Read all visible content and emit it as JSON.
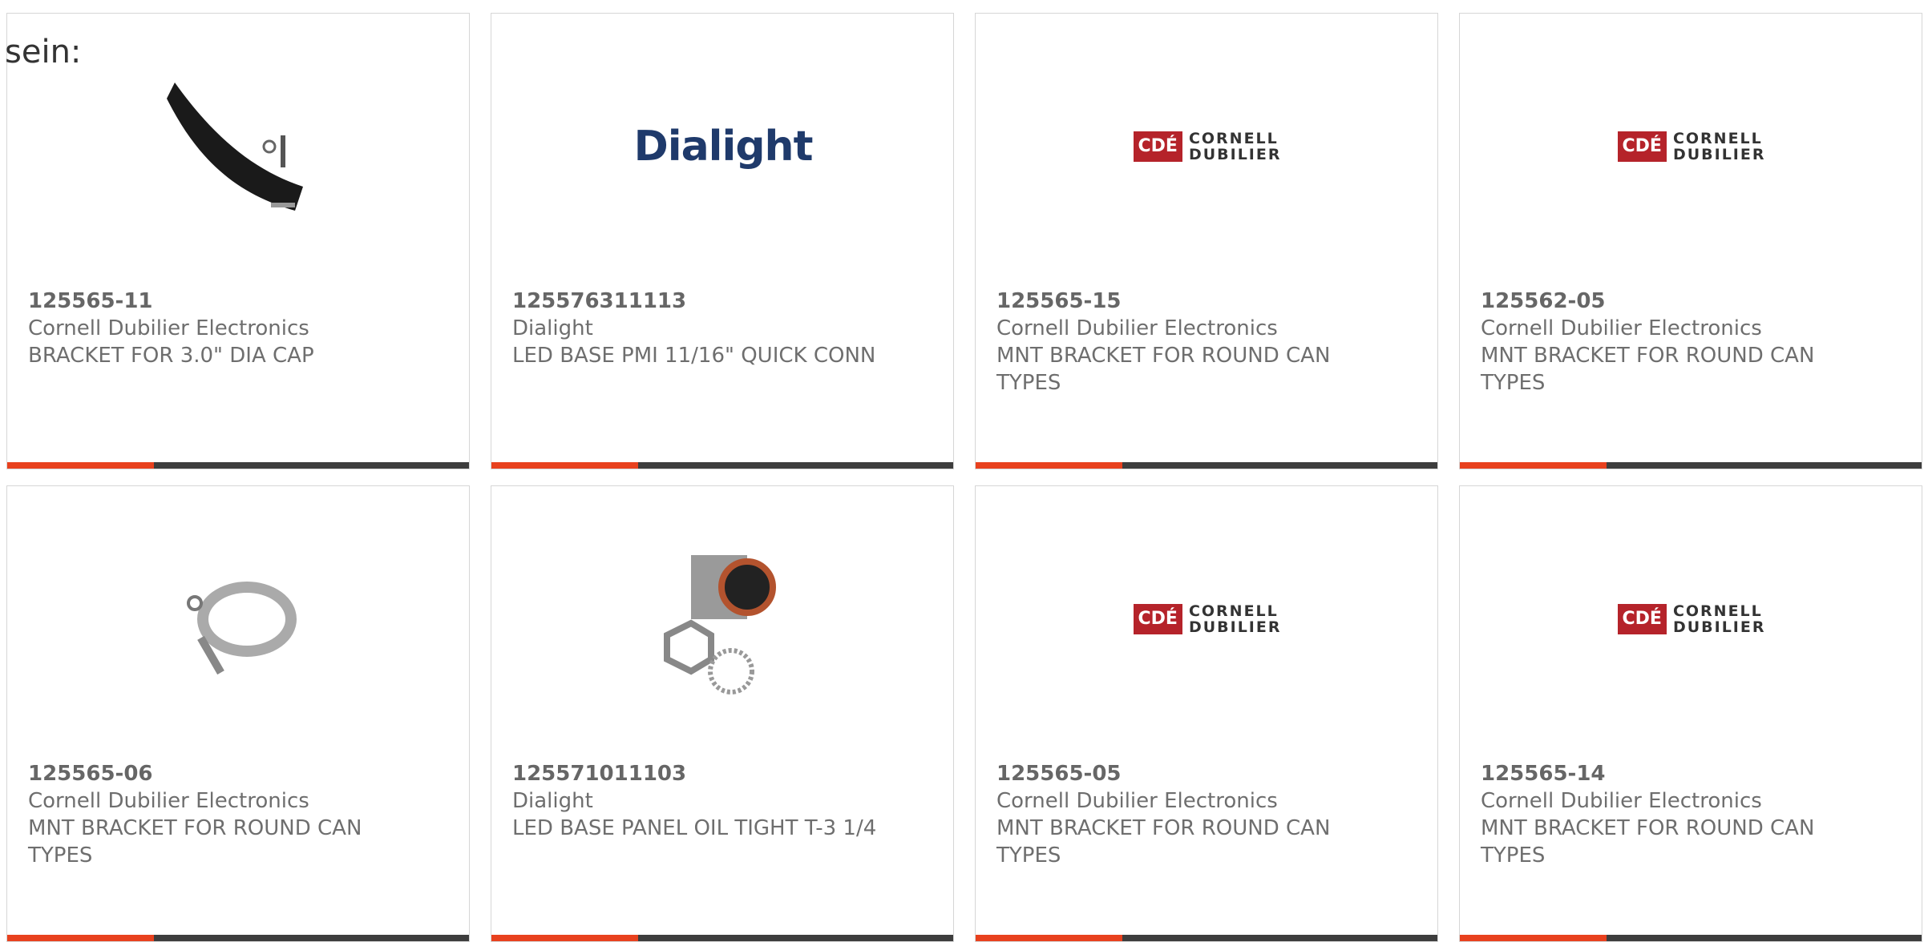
{
  "lead_text": "sein:",
  "accent_color": "#e8411e",
  "bar_color": "#3d3d3d",
  "products": [
    {
      "part": "125565-11",
      "mfr": "Cornell Dubilier Electronics",
      "desc": "BRACKET FOR 3.0\" DIA CAP",
      "image": "bracket-photo-icon"
    },
    {
      "part": "125576311113",
      "mfr": "Dialight",
      "desc": "LED BASE PMI 11/16\" QUICK CONN",
      "image": "dialight-logo",
      "logo_text": "Dialight"
    },
    {
      "part": "125565-15",
      "mfr": "Cornell Dubilier Electronics",
      "desc": "MNT BRACKET FOR ROUND CAN TYPES",
      "image": "cde-logo",
      "logo_mark": "CDÉ",
      "logo_line1": "CORNELL",
      "logo_line2": "DUBILIER"
    },
    {
      "part": "125562-05",
      "mfr": "Cornell Dubilier Electronics",
      "desc": "MNT BRACKET FOR ROUND CAN TYPES",
      "image": "cde-logo",
      "logo_mark": "CDÉ",
      "logo_line1": "CORNELL",
      "logo_line2": "DUBILIER"
    },
    {
      "part": "125565-06",
      "mfr": "Cornell Dubilier Electronics",
      "desc": "MNT BRACKET FOR ROUND CAN TYPES",
      "image": "clamp-photo-icon"
    },
    {
      "part": "125571011103",
      "mfr": "Dialight",
      "desc": "LED BASE PANEL OIL TIGHT T-3 1/4",
      "image": "led-base-photo-icon"
    },
    {
      "part": "125565-05",
      "mfr": "Cornell Dubilier Electronics",
      "desc": "MNT BRACKET FOR ROUND CAN TYPES",
      "image": "cde-logo",
      "logo_mark": "CDÉ",
      "logo_line1": "CORNELL",
      "logo_line2": "DUBILIER"
    },
    {
      "part": "125565-14",
      "mfr": "Cornell Dubilier Electronics",
      "desc": "MNT BRACKET FOR ROUND CAN TYPES",
      "image": "cde-logo",
      "logo_mark": "CDÉ",
      "logo_line1": "CORNELL",
      "logo_line2": "DUBILIER"
    }
  ]
}
